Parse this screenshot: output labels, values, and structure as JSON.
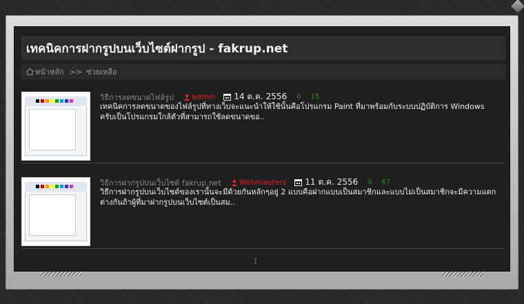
{
  "page": {
    "title": "เทคนิคการฝากรูปบนเว็บไซต์ฝากรูป - fakrup.net"
  },
  "breadcrumb": {
    "home": "หน้าหลัก",
    "separator": ">>",
    "current": "ช่วยเหลือ"
  },
  "articles": [
    {
      "category": "วิธีการลดขนาดไฟล์รูป",
      "author": "admin",
      "date": "14 ต.ค. 2556",
      "count_a": "0",
      "count_b": "15",
      "excerpt": "เทคนิคการลดขนาดของไฟล์รูปที่ทางเว็บจะแนะนำให้ใช้นั้นคือโปรแกรม Paint ที่มาพร้อมกับระบบปฏิบัติการ Windows ครับเป็นโปรแกรมใกล้ตัวที่สามารถใช้ลดขนาดขอ.."
    },
    {
      "category": "วิธีการฝากรูปบนเว็บไซต์ fakrup.net",
      "author": "Webmasters",
      "date": "11 ต.ค. 2556",
      "count_a": "0",
      "count_b": "67",
      "excerpt": "วิธีการฝากรูปบนเว็บไซต์ของเรานั้นจะมีด้วยกันหลักๆอยู่ 2 แบบคือฝากแบบเป็นสมาชิกและแบบไม่เป็นสมาชิกจะมีความแตกต่างกันถ้าผู้ที่มาฝากรูปบนเว็บไซต์เป็นสม.."
    }
  ],
  "pagination": {
    "current": "1"
  },
  "colors": {
    "author": "#e02020",
    "counts": "#2f8f2f",
    "panel": "#1f1f1f"
  }
}
